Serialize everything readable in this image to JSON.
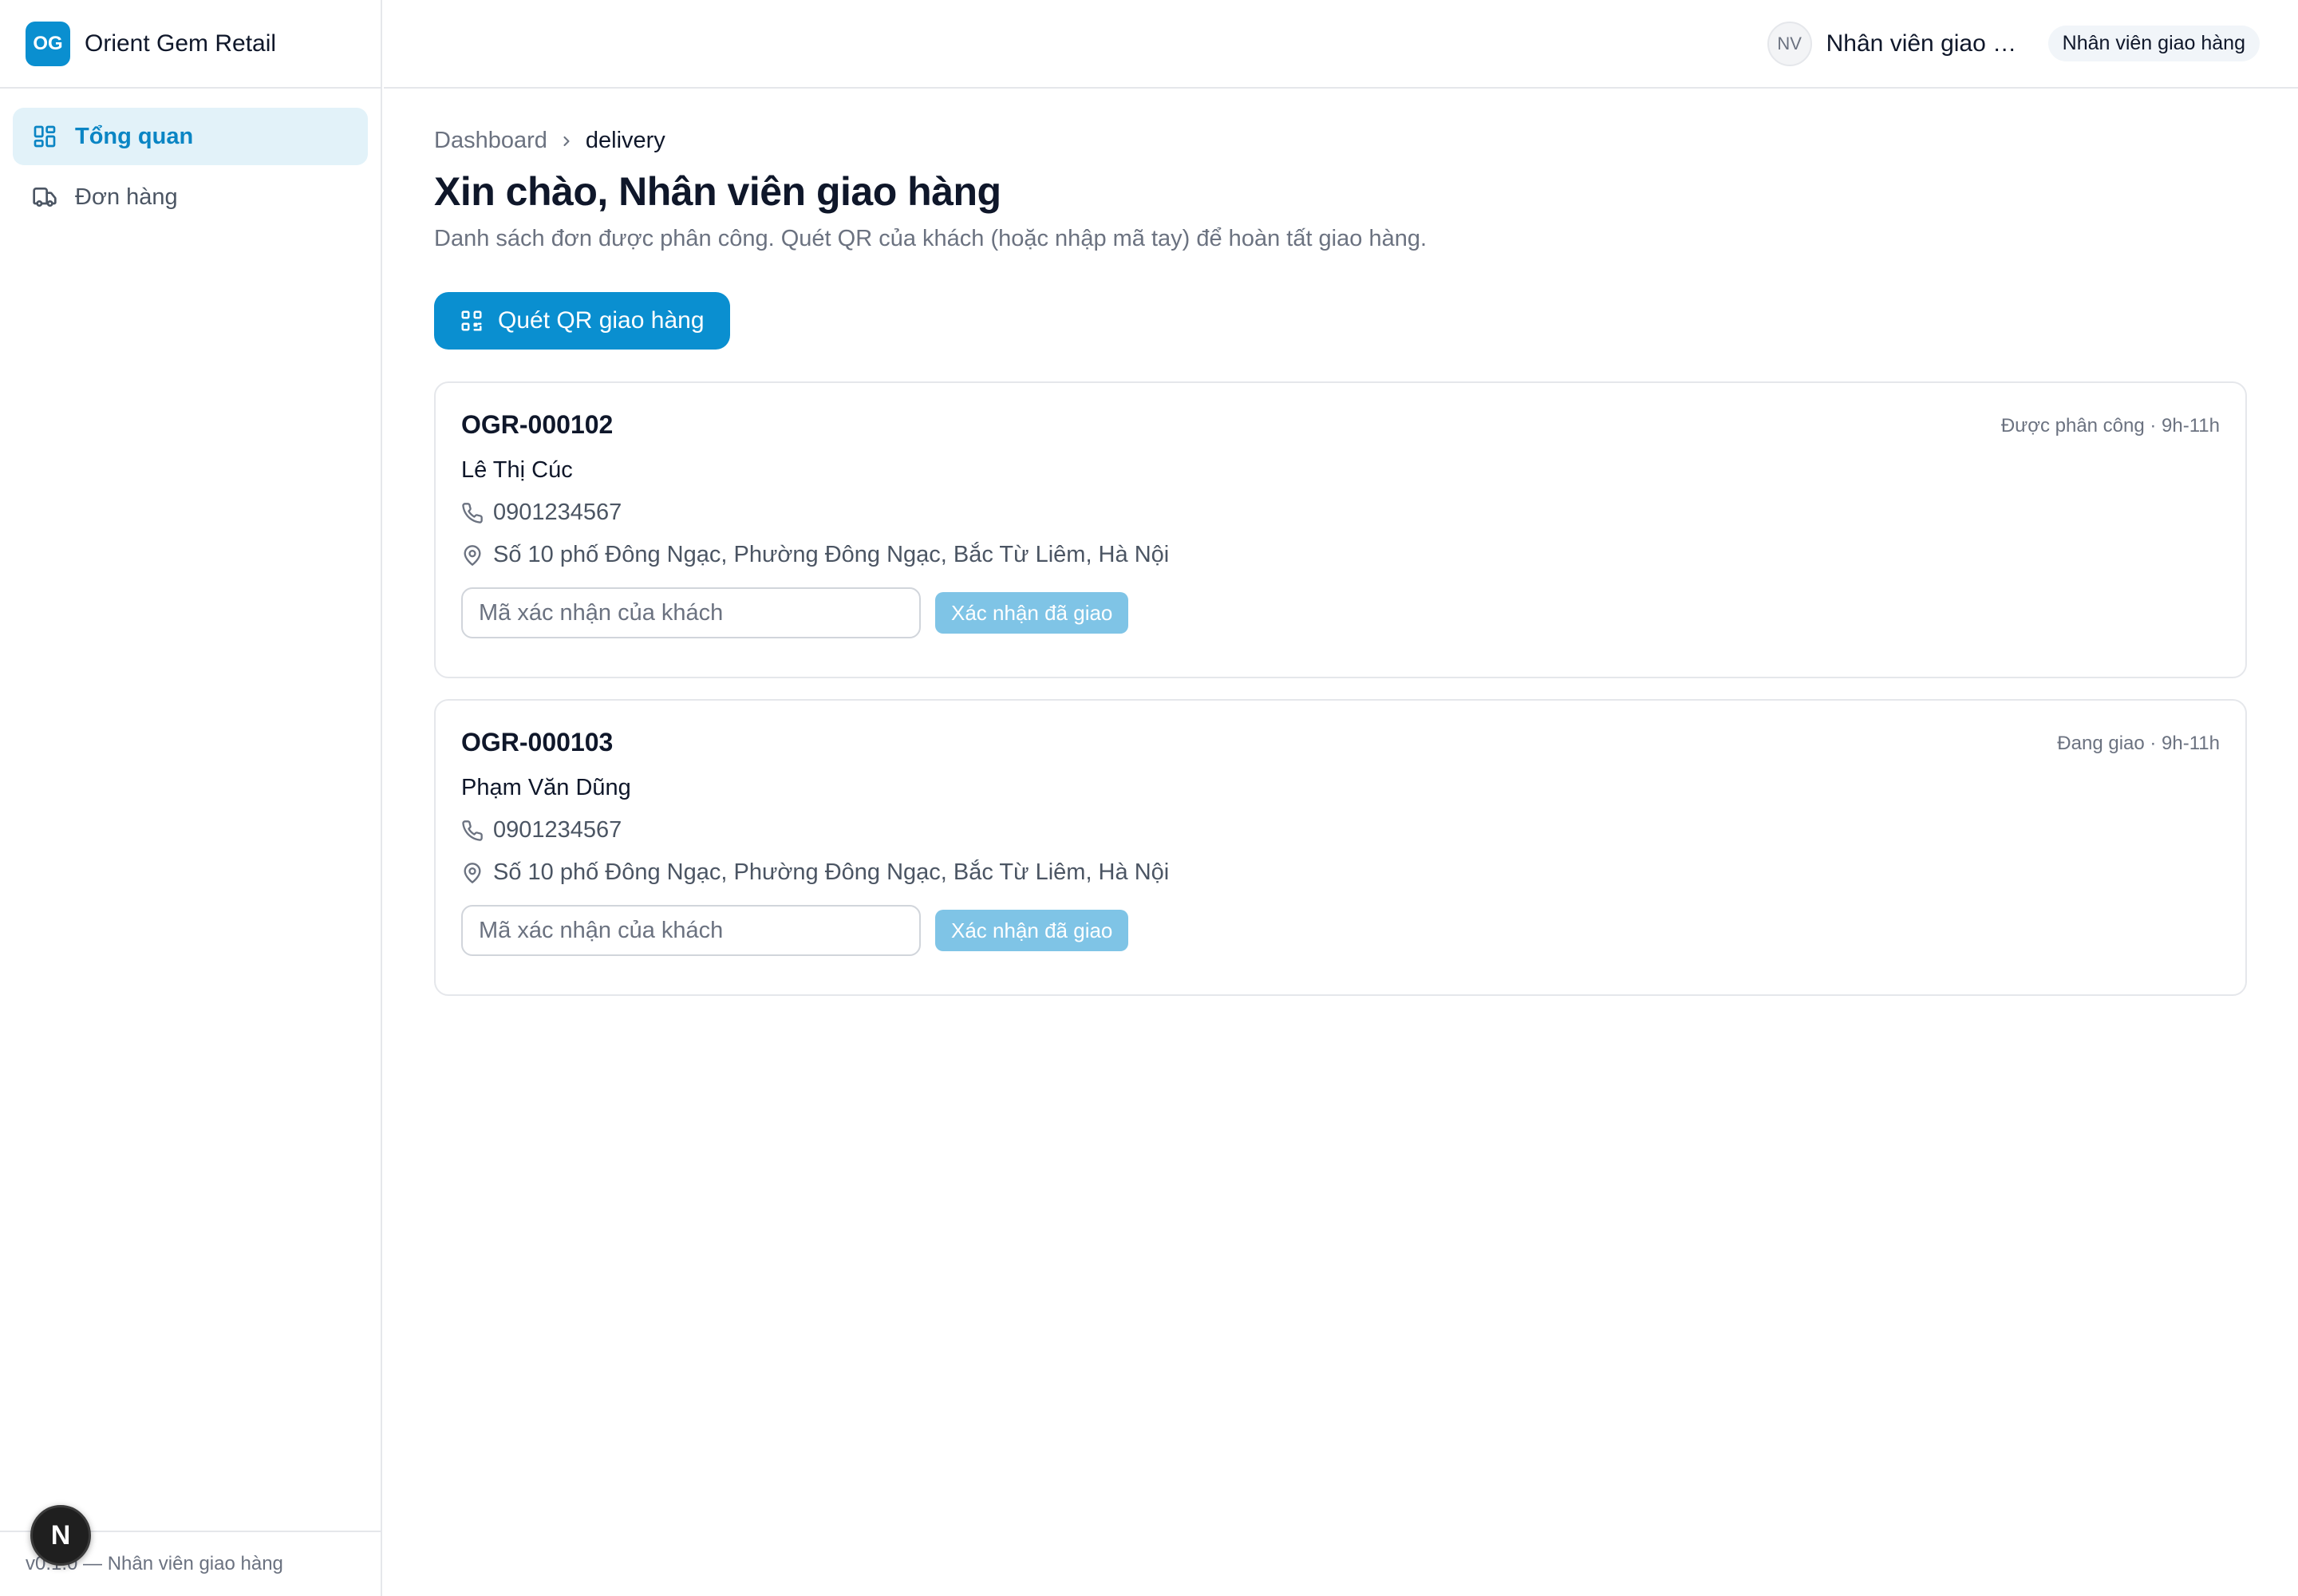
{
  "brand": {
    "logo_text": "OG",
    "name": "Orient Gem Retail"
  },
  "sidebar": {
    "items": [
      {
        "label": "Tổng quan",
        "icon": "dashboard-grid-icon",
        "active": true
      },
      {
        "label": "Đơn hàng",
        "icon": "truck-icon",
        "active": false
      }
    ],
    "footer": "v0.1.0 — Nhân viên giao hàng"
  },
  "header": {
    "avatar_initials": "NV",
    "user_name": "Nhân viên giao h...",
    "role": "Nhân viên giao hàng"
  },
  "breadcrumb": {
    "root": "Dashboard",
    "current": "delivery"
  },
  "page": {
    "title": "Xin chào, Nhân viên giao hàng",
    "subtitle": "Danh sách đơn được phân công. Quét QR của khách (hoặc nhập mã tay) để hoàn tất giao hàng.",
    "scan_button": "Quét QR giao hàng"
  },
  "orders": [
    {
      "code": "OGR-000102",
      "meta": "Được phân công · 9h-11h",
      "customer": "Lê Thị Cúc",
      "phone": "0901234567",
      "address": "Số 10 phố Đông Ngạc, Phường Đông Ngạc, Bắc Từ Liêm, Hà Nội",
      "input_placeholder": "Mã xác nhận của khách",
      "confirm_label": "Xác nhận đã giao"
    },
    {
      "code": "OGR-000103",
      "meta": "Đang giao · 9h-11h",
      "customer": "Phạm Văn Dũng",
      "phone": "0901234567",
      "address": "Số 10 phố Đông Ngạc, Phường Đông Ngạc, Bắc Từ Liêm, Hà Nội",
      "input_placeholder": "Mã xác nhận của khách",
      "confirm_label": "Xác nhận đã giao"
    }
  ],
  "dev_badge": "N",
  "colors": {
    "accent": "#0a8fd0",
    "accent_light": "#e2f2f9",
    "confirm_disabled": "#7fc4e6",
    "border": "#e5e7eb",
    "muted_text": "#6b7280"
  }
}
